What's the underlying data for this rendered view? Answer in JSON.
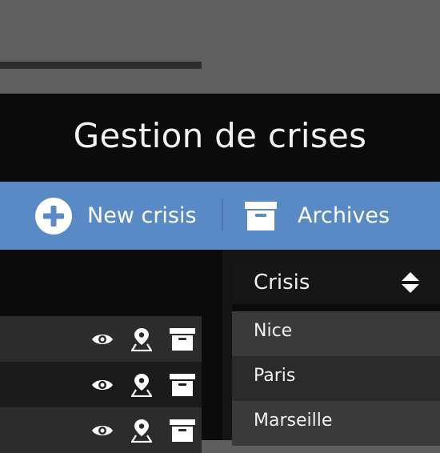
{
  "app": {
    "title": "Gestion de crises"
  },
  "toolbar": {
    "new_crisis_label": "New crisis",
    "archives_label": "Archives",
    "accent": "#5a8ac6"
  },
  "left_list": {
    "row_actions": [
      "view-icon",
      "map-pin-icon",
      "archive-icon"
    ],
    "rows": [
      {},
      {},
      {}
    ]
  },
  "crisis_list": {
    "header_label": "Crisis",
    "sort_icon": "sort-updown-icon",
    "items": [
      {
        "label": "Nice"
      },
      {
        "label": "Paris"
      },
      {
        "label": "Marseille"
      }
    ]
  }
}
